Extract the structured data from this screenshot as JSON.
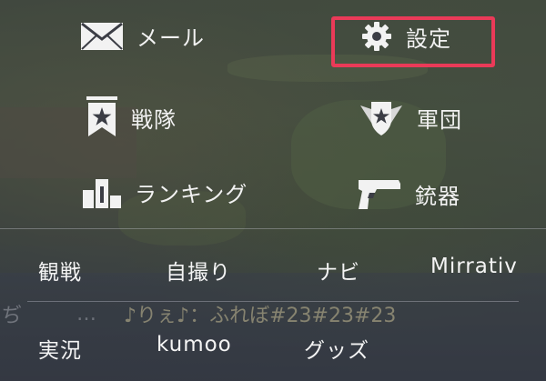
{
  "menu": {
    "mail": {
      "label": "メール",
      "icon": "envelope-icon"
    },
    "settings": {
      "label": "設定",
      "icon": "gear-icon",
      "highlighted": true
    },
    "squad": {
      "label": "戦隊",
      "icon": "star-bookmark-icon"
    },
    "corps": {
      "label": "軍団",
      "icon": "winged-star-emblem-icon"
    },
    "ranking": {
      "label": "ランキング",
      "icon": "podium-icon"
    },
    "weapons": {
      "label": "銃器",
      "icon": "pistol-icon"
    }
  },
  "links": {
    "watch": "観戦",
    "selfie": "自撮り",
    "navi": "ナビ",
    "mirrativ": "Mirrativ",
    "live": "実況",
    "kumoo": "kumoo",
    "goods": "グッズ"
  },
  "chat": {
    "edge_text": "ぢ",
    "dots": "…",
    "message": "♪りぇ♪：ふれぼ#23#23#23"
  },
  "colors": {
    "highlight": "#ea3a58",
    "text": "#f2f2f2",
    "overlay": "#262830"
  }
}
